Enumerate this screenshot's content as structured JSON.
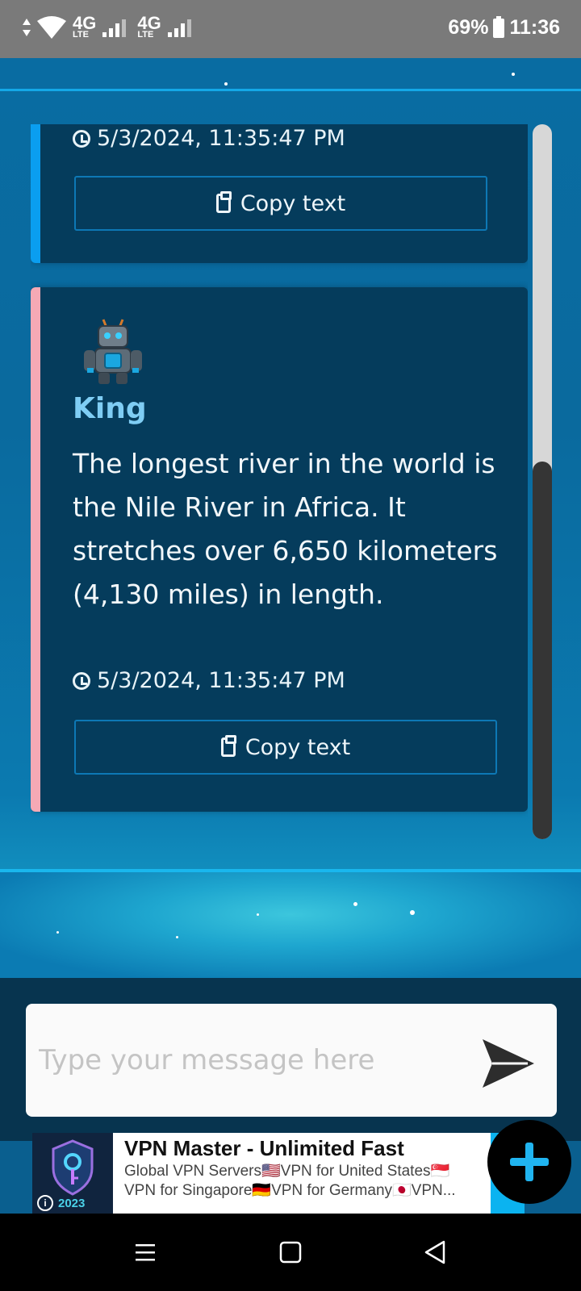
{
  "status_bar": {
    "network_1": "4G",
    "network_1_sub": "LTE",
    "network_2": "4G",
    "network_2_sub": "LTE",
    "battery": "69%",
    "time": "11:36"
  },
  "chat": {
    "messages": [
      {
        "timestamp": "5/3/2024, 11:35:47 PM",
        "copy_label": "Copy text",
        "accent_color": "#0a9ef0"
      },
      {
        "sender": "King",
        "avatar_icon": "robot-avatar-icon",
        "text": "The longest river in the world is the Nile River in Africa. It stretches over 6,650 kilometers (4,130 miles) in length.",
        "timestamp": "5/3/2024, 11:35:47 PM",
        "copy_label": "Copy text",
        "accent_color": "#f5a9b5"
      }
    ]
  },
  "composer": {
    "placeholder": "Type your message here",
    "value": "",
    "send_icon": "send-icon"
  },
  "ad": {
    "title": "VPN Master - Unlimited Fast",
    "description": "Global VPN Servers🇺🇸VPN for United States🇸🇬VPN for Singapore🇩🇪VPN for Germany🇯🇵VPN...",
    "icon_year": "2023",
    "info_glyph": "i"
  },
  "fab": {
    "icon": "plus-icon"
  },
  "nav": {
    "buttons": [
      "menu-icon",
      "home-square-icon",
      "back-triangle-icon"
    ]
  }
}
